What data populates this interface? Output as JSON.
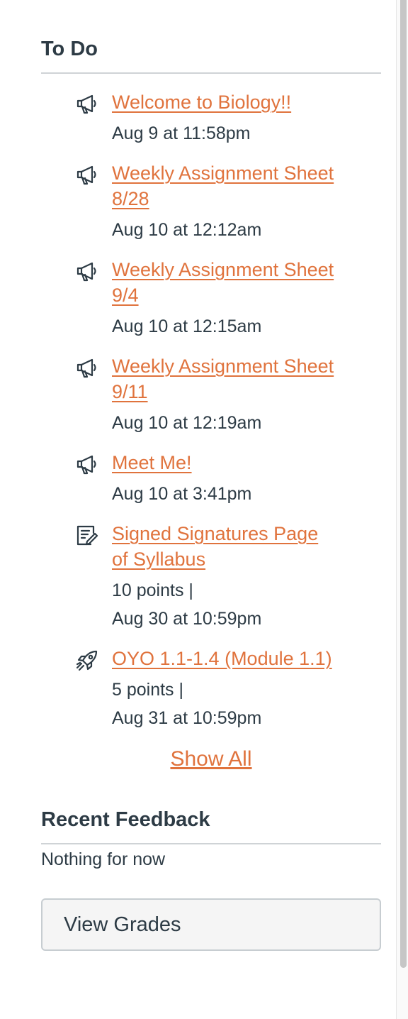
{
  "todo": {
    "title": "To Do",
    "items": [
      {
        "type": "announcement",
        "icon": "megaphone-icon",
        "title": "Welcome to Biology!!",
        "meta": [
          "Aug 9 at 11:58pm"
        ]
      },
      {
        "type": "announcement",
        "icon": "megaphone-icon",
        "title": "Weekly Assignment Sheet 8/28",
        "meta": [
          "Aug 10 at 12:12am"
        ]
      },
      {
        "type": "announcement",
        "icon": "megaphone-icon",
        "title": "Weekly Assignment Sheet 9/4",
        "meta": [
          "Aug 10 at 12:15am"
        ]
      },
      {
        "type": "announcement",
        "icon": "megaphone-icon",
        "title": "Weekly Assignment Sheet 9/11",
        "meta": [
          "Aug 10 at 12:19am"
        ]
      },
      {
        "type": "announcement",
        "icon": "megaphone-icon",
        "title": "Meet Me!",
        "meta": [
          "Aug 10 at 3:41pm"
        ]
      },
      {
        "type": "assignment",
        "icon": "assignment-icon",
        "title": "Signed Signatures Page of Syllabus",
        "meta": [
          "10 points  |",
          "Aug 30 at 10:59pm"
        ]
      },
      {
        "type": "quiz",
        "icon": "rocket-icon",
        "title": "OYO 1.1-1.4 (Module 1.1)",
        "meta": [
          "5 points  |",
          "Aug 31 at 10:59pm"
        ]
      }
    ],
    "show_all_label": "Show All"
  },
  "feedback": {
    "title": "Recent Feedback",
    "empty_text": "Nothing for now"
  },
  "view_grades_label": "View Grades",
  "colors": {
    "link": "#e0733d",
    "text": "#2d3b45",
    "divider": "#cfd3d6"
  }
}
